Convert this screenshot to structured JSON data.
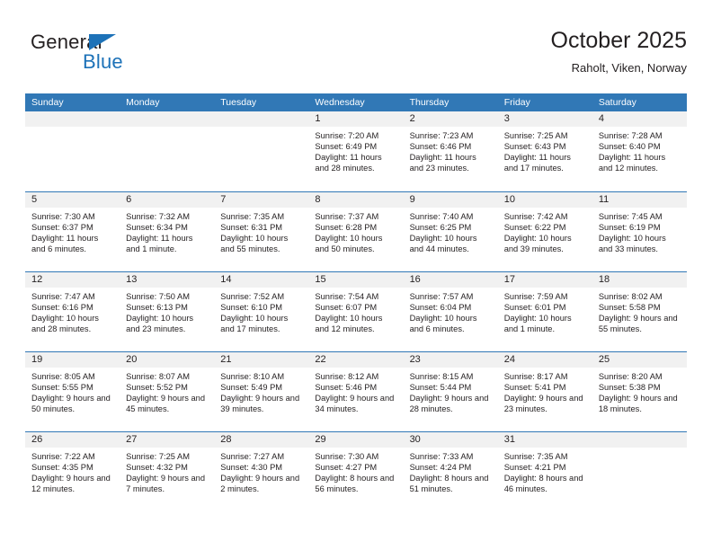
{
  "brand": {
    "name_part1": "General",
    "name_part2": "Blue"
  },
  "header": {
    "title": "October 2025",
    "subtitle": "Raholt, Viken, Norway"
  },
  "weekdays": [
    "Sunday",
    "Monday",
    "Tuesday",
    "Wednesday",
    "Thursday",
    "Friday",
    "Saturday"
  ],
  "colors": {
    "header_blue": "#3178b6",
    "brand_blue": "#1d72b8",
    "daynum_band": "#f1f1f1",
    "text": "#231f20"
  },
  "labels": {
    "sunrise_prefix": "Sunrise:",
    "sunset_prefix": "Sunset:",
    "daylight_prefix": "Daylight:"
  },
  "weeks": [
    [
      {
        "day": "",
        "sunrise": "",
        "sunset": "",
        "daylight": ""
      },
      {
        "day": "",
        "sunrise": "",
        "sunset": "",
        "daylight": ""
      },
      {
        "day": "",
        "sunrise": "",
        "sunset": "",
        "daylight": ""
      },
      {
        "day": "1",
        "sunrise": "Sunrise: 7:20 AM",
        "sunset": "Sunset: 6:49 PM",
        "daylight": "Daylight: 11 hours and 28 minutes."
      },
      {
        "day": "2",
        "sunrise": "Sunrise: 7:23 AM",
        "sunset": "Sunset: 6:46 PM",
        "daylight": "Daylight: 11 hours and 23 minutes."
      },
      {
        "day": "3",
        "sunrise": "Sunrise: 7:25 AM",
        "sunset": "Sunset: 6:43 PM",
        "daylight": "Daylight: 11 hours and 17 minutes."
      },
      {
        "day": "4",
        "sunrise": "Sunrise: 7:28 AM",
        "sunset": "Sunset: 6:40 PM",
        "daylight": "Daylight: 11 hours and 12 minutes."
      }
    ],
    [
      {
        "day": "5",
        "sunrise": "Sunrise: 7:30 AM",
        "sunset": "Sunset: 6:37 PM",
        "daylight": "Daylight: 11 hours and 6 minutes."
      },
      {
        "day": "6",
        "sunrise": "Sunrise: 7:32 AM",
        "sunset": "Sunset: 6:34 PM",
        "daylight": "Daylight: 11 hours and 1 minute."
      },
      {
        "day": "7",
        "sunrise": "Sunrise: 7:35 AM",
        "sunset": "Sunset: 6:31 PM",
        "daylight": "Daylight: 10 hours and 55 minutes."
      },
      {
        "day": "8",
        "sunrise": "Sunrise: 7:37 AM",
        "sunset": "Sunset: 6:28 PM",
        "daylight": "Daylight: 10 hours and 50 minutes."
      },
      {
        "day": "9",
        "sunrise": "Sunrise: 7:40 AM",
        "sunset": "Sunset: 6:25 PM",
        "daylight": "Daylight: 10 hours and 44 minutes."
      },
      {
        "day": "10",
        "sunrise": "Sunrise: 7:42 AM",
        "sunset": "Sunset: 6:22 PM",
        "daylight": "Daylight: 10 hours and 39 minutes."
      },
      {
        "day": "11",
        "sunrise": "Sunrise: 7:45 AM",
        "sunset": "Sunset: 6:19 PM",
        "daylight": "Daylight: 10 hours and 33 minutes."
      }
    ],
    [
      {
        "day": "12",
        "sunrise": "Sunrise: 7:47 AM",
        "sunset": "Sunset: 6:16 PM",
        "daylight": "Daylight: 10 hours and 28 minutes."
      },
      {
        "day": "13",
        "sunrise": "Sunrise: 7:50 AM",
        "sunset": "Sunset: 6:13 PM",
        "daylight": "Daylight: 10 hours and 23 minutes."
      },
      {
        "day": "14",
        "sunrise": "Sunrise: 7:52 AM",
        "sunset": "Sunset: 6:10 PM",
        "daylight": "Daylight: 10 hours and 17 minutes."
      },
      {
        "day": "15",
        "sunrise": "Sunrise: 7:54 AM",
        "sunset": "Sunset: 6:07 PM",
        "daylight": "Daylight: 10 hours and 12 minutes."
      },
      {
        "day": "16",
        "sunrise": "Sunrise: 7:57 AM",
        "sunset": "Sunset: 6:04 PM",
        "daylight": "Daylight: 10 hours and 6 minutes."
      },
      {
        "day": "17",
        "sunrise": "Sunrise: 7:59 AM",
        "sunset": "Sunset: 6:01 PM",
        "daylight": "Daylight: 10 hours and 1 minute."
      },
      {
        "day": "18",
        "sunrise": "Sunrise: 8:02 AM",
        "sunset": "Sunset: 5:58 PM",
        "daylight": "Daylight: 9 hours and 55 minutes."
      }
    ],
    [
      {
        "day": "19",
        "sunrise": "Sunrise: 8:05 AM",
        "sunset": "Sunset: 5:55 PM",
        "daylight": "Daylight: 9 hours and 50 minutes."
      },
      {
        "day": "20",
        "sunrise": "Sunrise: 8:07 AM",
        "sunset": "Sunset: 5:52 PM",
        "daylight": "Daylight: 9 hours and 45 minutes."
      },
      {
        "day": "21",
        "sunrise": "Sunrise: 8:10 AM",
        "sunset": "Sunset: 5:49 PM",
        "daylight": "Daylight: 9 hours and 39 minutes."
      },
      {
        "day": "22",
        "sunrise": "Sunrise: 8:12 AM",
        "sunset": "Sunset: 5:46 PM",
        "daylight": "Daylight: 9 hours and 34 minutes."
      },
      {
        "day": "23",
        "sunrise": "Sunrise: 8:15 AM",
        "sunset": "Sunset: 5:44 PM",
        "daylight": "Daylight: 9 hours and 28 minutes."
      },
      {
        "day": "24",
        "sunrise": "Sunrise: 8:17 AM",
        "sunset": "Sunset: 5:41 PM",
        "daylight": "Daylight: 9 hours and 23 minutes."
      },
      {
        "day": "25",
        "sunrise": "Sunrise: 8:20 AM",
        "sunset": "Sunset: 5:38 PM",
        "daylight": "Daylight: 9 hours and 18 minutes."
      }
    ],
    [
      {
        "day": "26",
        "sunrise": "Sunrise: 7:22 AM",
        "sunset": "Sunset: 4:35 PM",
        "daylight": "Daylight: 9 hours and 12 minutes."
      },
      {
        "day": "27",
        "sunrise": "Sunrise: 7:25 AM",
        "sunset": "Sunset: 4:32 PM",
        "daylight": "Daylight: 9 hours and 7 minutes."
      },
      {
        "day": "28",
        "sunrise": "Sunrise: 7:27 AM",
        "sunset": "Sunset: 4:30 PM",
        "daylight": "Daylight: 9 hours and 2 minutes."
      },
      {
        "day": "29",
        "sunrise": "Sunrise: 7:30 AM",
        "sunset": "Sunset: 4:27 PM",
        "daylight": "Daylight: 8 hours and 56 minutes."
      },
      {
        "day": "30",
        "sunrise": "Sunrise: 7:33 AM",
        "sunset": "Sunset: 4:24 PM",
        "daylight": "Daylight: 8 hours and 51 minutes."
      },
      {
        "day": "31",
        "sunrise": "Sunrise: 7:35 AM",
        "sunset": "Sunset: 4:21 PM",
        "daylight": "Daylight: 8 hours and 46 minutes."
      },
      {
        "day": "",
        "sunrise": "",
        "sunset": "",
        "daylight": ""
      }
    ]
  ]
}
